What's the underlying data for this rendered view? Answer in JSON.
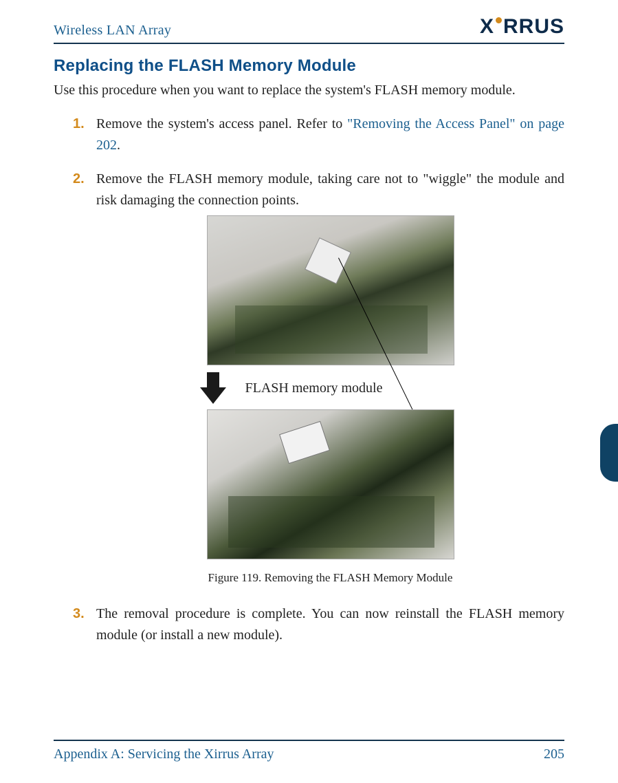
{
  "header": {
    "doc_title": "Wireless LAN Array",
    "logo_left": "X",
    "logo_right": "RRUS"
  },
  "section": {
    "heading": "Replacing the FLASH Memory Module",
    "intro": "Use this procedure when you want to replace the system's FLASH memory module."
  },
  "steps": [
    {
      "num": "1.",
      "text_before": "Remove the system's access panel. Refer to ",
      "xref": "\"Removing the Access Panel\" on page 202",
      "text_after": "."
    },
    {
      "num": "2.",
      "text": "Remove the FLASH memory module, taking care not to \"wiggle\" the module and risk damaging the connection points."
    },
    {
      "num": "3.",
      "text": "The removal procedure is complete. You can now reinstall the FLASH memory module (or install a new module)."
    }
  ],
  "figure": {
    "callout": "FLASH memory module",
    "caption": "Figure 119. Removing the FLASH Memory Module"
  },
  "footer": {
    "appendix": "Appendix A: Servicing the Xirrus Array",
    "page": "205"
  }
}
